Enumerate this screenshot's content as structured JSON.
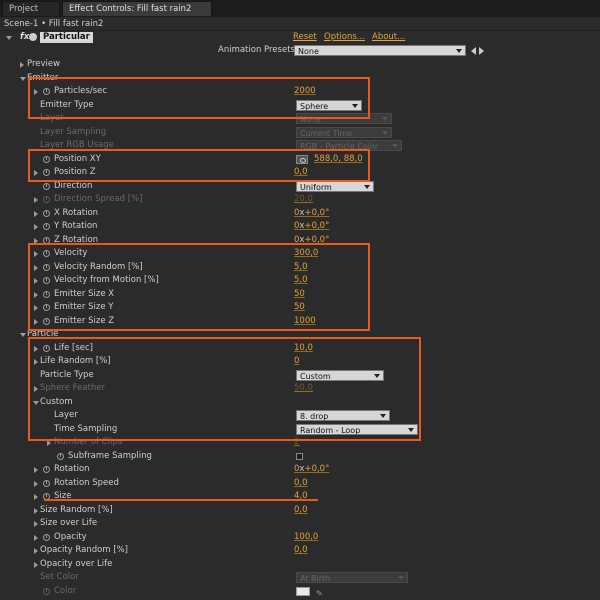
{
  "tabs": {
    "project": "Project",
    "effect_controls": "Effect Controls: Fill fast rain2",
    "close": "×"
  },
  "breadcrumb": "Scene-1 • Fill fast rain2",
  "effect": {
    "fx": "fx",
    "name": "Particular",
    "reset": "Reset",
    "options": "Options...",
    "about": "About..."
  },
  "presets": {
    "label": "Animation Presets:",
    "value": "None"
  },
  "rows": {
    "preview": "Preview",
    "emitter": "Emitter",
    "particles_sec": {
      "label": "Particles/sec",
      "value": "2000"
    },
    "emitter_type": {
      "label": "Emitter Type",
      "value": "Sphere"
    },
    "layer": {
      "label": "Layer",
      "value": "None"
    },
    "layer_sampling": {
      "label": "Layer Sampling",
      "value": "Current Time"
    },
    "layer_rgb": {
      "label": "Layer RGB Usage",
      "value": "RGB - Particle Color"
    },
    "position_xy": {
      "label": "Position XY",
      "value": "588,0, 88,0"
    },
    "position_z": {
      "label": "Position Z",
      "value": "0,0"
    },
    "direction": {
      "label": "Direction",
      "value": "Uniform"
    },
    "direction_spread": {
      "label": "Direction Spread [%]",
      "value": "20,0"
    },
    "x_rotation": {
      "label": "X Rotation",
      "value_a": "0",
      "value_b": "+0,0°"
    },
    "y_rotation": {
      "label": "Y Rotation",
      "value_a": "0",
      "value_b": "+0,0°"
    },
    "z_rotation": {
      "label": "Z Rotation",
      "value_a": "0",
      "value_b": "+0,0°"
    },
    "velocity": {
      "label": "Velocity",
      "value": "300,0"
    },
    "velocity_random": {
      "label": "Velocity Random [%]",
      "value": "5,0"
    },
    "velocity_motion": {
      "label": "Velocity from Motion [%]",
      "value": "5,0"
    },
    "emitter_size_x": {
      "label": "Emitter Size X",
      "value": "50"
    },
    "emitter_size_y": {
      "label": "Emitter Size Y",
      "value": "50"
    },
    "emitter_size_z": {
      "label": "Emitter Size Z",
      "value": "1000"
    },
    "particle": "Particle",
    "life": {
      "label": "Life [sec]",
      "value": "10,0"
    },
    "life_random": {
      "label": "Life Random [%]",
      "value": "0"
    },
    "particle_type": {
      "label": "Particle Type",
      "value": "Custom"
    },
    "sphere_feather": {
      "label": "Sphere Feather",
      "value": "50,0"
    },
    "custom": "Custom",
    "custom_layer": {
      "label": "Layer",
      "value": "8. drop"
    },
    "time_sampling": {
      "label": "Time Sampling",
      "value": "Random - Loop"
    },
    "number_clips": {
      "label": "Number of Clips",
      "value": "2"
    },
    "subframe": {
      "label": "Subframe Sampling"
    },
    "rotation": {
      "label": "Rotation",
      "value_a": "0",
      "value_b": "+0,0°"
    },
    "rotation_speed": {
      "label": "Rotation Speed",
      "value": "0,0"
    },
    "size": {
      "label": "Size",
      "value": "4,0"
    },
    "size_random": {
      "label": "Size Random [%]",
      "value": "0,0"
    },
    "size_over_life": "Size over Life",
    "opacity": {
      "label": "Opacity",
      "value": "100,0"
    },
    "opacity_random": {
      "label": "Opacity Random [%]",
      "value": "0,0"
    },
    "opacity_over_life": "Opacity over Life",
    "set_color": {
      "label": "Set Color",
      "value": "At Birth"
    },
    "color": {
      "label": "Color"
    }
  },
  "multiplier": "x",
  "accent": "#e3a43a",
  "highlight": "#e85a1e"
}
